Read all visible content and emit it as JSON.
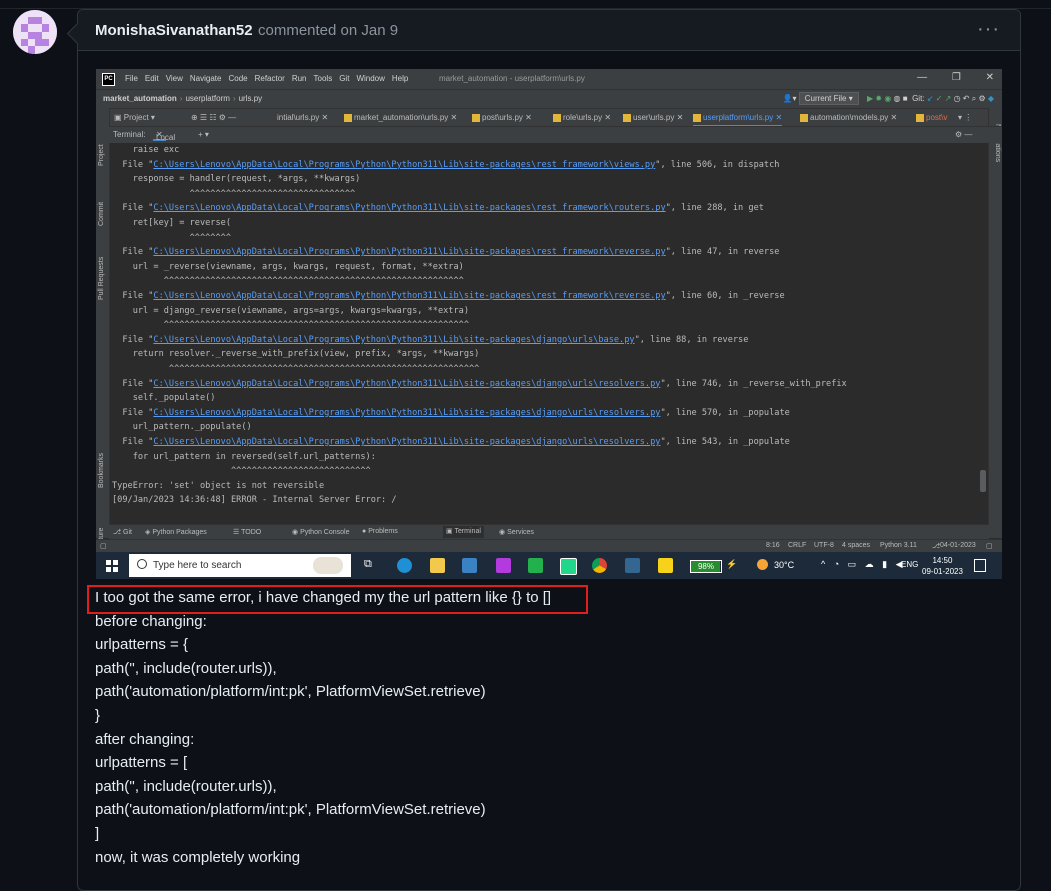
{
  "comment": {
    "author": "MonishaSivanathan52",
    "meta": "commented on Jan 9",
    "menu_icon": "kebab-icon",
    "highlight_color": "#e01e1e",
    "lines": [
      "I too got the same error, i have changed my the url pattern like {} to []",
      "before changing:",
      "urlpatterns = {",
      "path('', include(router.urls)),",
      "path('automation/platform/int:pk', PlatformViewSet.retrieve)",
      "}",
      "after changing:",
      "urlpatterns = [",
      "path('', include(router.urls)),",
      "path('automation/platform/int:pk', PlatformViewSet.retrieve)",
      "]",
      "now, it was completely working"
    ]
  },
  "ide": {
    "menu": [
      "File",
      "Edit",
      "View",
      "Navigate",
      "Code",
      "Refactor",
      "Run",
      "Tools",
      "Git",
      "Window",
      "Help"
    ],
    "window_title": "market_automation - userplatform\\urls.py",
    "breadcrumb": [
      "market_automation",
      "userplatform",
      "urls.py"
    ],
    "current_file": "Current File",
    "git_label": "Git:",
    "project_label": "Project",
    "tabs": [
      "intial\\urls.py",
      "market_automation\\urls.py",
      "post\\urls.py",
      "role\\urls.py",
      "user\\urls.py",
      "userplatform\\urls.py",
      "automation\\models.py",
      "post\\v"
    ],
    "terminal_label": "Terminal:",
    "local_tab": "Local",
    "left_tools": [
      "Project",
      "Commit",
      "Pull Requests",
      "Bookmarks",
      "Structure"
    ],
    "right_tools": [
      "Notifications"
    ],
    "terminal_lines": [
      {
        "pre": "    raise exc",
        "link": "",
        "post": ""
      },
      {
        "pre": "  File \"",
        "link": "C:\\Users\\Lenovo\\AppData\\Local\\Programs\\Python\\Python311\\Lib\\site-packages\\rest_framework\\views.py",
        "post": "\", line 506, in dispatch"
      },
      {
        "pre": "    response = handler(request, *args, **kwargs)",
        "link": "",
        "post": ""
      },
      {
        "pre": "               ^^^^^^^^^^^^^^^^^^^^^^^^^^^^^^^^",
        "link": "",
        "post": ""
      },
      {
        "pre": "  File \"",
        "link": "C:\\Users\\Lenovo\\AppData\\Local\\Programs\\Python\\Python311\\Lib\\site-packages\\rest_framework\\routers.py",
        "post": "\", line 288, in get"
      },
      {
        "pre": "    ret[key] = reverse(",
        "link": "",
        "post": ""
      },
      {
        "pre": "               ^^^^^^^^",
        "link": "",
        "post": ""
      },
      {
        "pre": "  File \"",
        "link": "C:\\Users\\Lenovo\\AppData\\Local\\Programs\\Python\\Python311\\Lib\\site-packages\\rest_framework\\reverse.py",
        "post": "\", line 47, in reverse"
      },
      {
        "pre": "    url = _reverse(viewname, args, kwargs, request, format, **extra)",
        "link": "",
        "post": ""
      },
      {
        "pre": "          ^^^^^^^^^^^^^^^^^^^^^^^^^^^^^^^^^^^^^^^^^^^^^^^^^^^^^^^^^^",
        "link": "",
        "post": ""
      },
      {
        "pre": "  File \"",
        "link": "C:\\Users\\Lenovo\\AppData\\Local\\Programs\\Python\\Python311\\Lib\\site-packages\\rest_framework\\reverse.py",
        "post": "\", line 60, in _reverse"
      },
      {
        "pre": "    url = django_reverse(viewname, args=args, kwargs=kwargs, **extra)",
        "link": "",
        "post": ""
      },
      {
        "pre": "          ^^^^^^^^^^^^^^^^^^^^^^^^^^^^^^^^^^^^^^^^^^^^^^^^^^^^^^^^^^^",
        "link": "",
        "post": ""
      },
      {
        "pre": "  File \"",
        "link": "C:\\Users\\Lenovo\\AppData\\Local\\Programs\\Python\\Python311\\Lib\\site-packages\\django\\urls\\base.py",
        "post": "\", line 88, in reverse"
      },
      {
        "pre": "    return resolver._reverse_with_prefix(view, prefix, *args, **kwargs)",
        "link": "",
        "post": ""
      },
      {
        "pre": "           ^^^^^^^^^^^^^^^^^^^^^^^^^^^^^^^^^^^^^^^^^^^^^^^^^^^^^^^^^^^^",
        "link": "",
        "post": ""
      },
      {
        "pre": "  File \"",
        "link": "C:\\Users\\Lenovo\\AppData\\Local\\Programs\\Python\\Python311\\Lib\\site-packages\\django\\urls\\resolvers.py",
        "post": "\", line 746, in _reverse_with_prefix"
      },
      {
        "pre": "    self._populate()",
        "link": "",
        "post": ""
      },
      {
        "pre": "  File \"",
        "link": "C:\\Users\\Lenovo\\AppData\\Local\\Programs\\Python\\Python311\\Lib\\site-packages\\django\\urls\\resolvers.py",
        "post": "\", line 570, in _populate"
      },
      {
        "pre": "    url_pattern._populate()",
        "link": "",
        "post": ""
      },
      {
        "pre": "  File \"",
        "link": "C:\\Users\\Lenovo\\AppData\\Local\\Programs\\Python\\Python311\\Lib\\site-packages\\django\\urls\\resolvers.py",
        "post": "\", line 543, in _populate"
      },
      {
        "pre": "    for url_pattern in reversed(self.url_patterns):",
        "link": "",
        "post": ""
      },
      {
        "pre": "                       ^^^^^^^^^^^^^^^^^^^^^^^^^^^",
        "link": "",
        "post": ""
      },
      {
        "pre": "TypeError: 'set' object is not reversible",
        "link": "",
        "post": ""
      },
      {
        "pre": "[09/Jan/2023 14:36:48] ERROR - Internal Server Error: /",
        "link": "",
        "post": ""
      }
    ],
    "bottom_tools": [
      "Git",
      "Python Packages",
      "TODO",
      "Python Console",
      "Problems",
      "Terminal",
      "Services"
    ],
    "status": {
      "position": "8:16",
      "line_ending": "CRLF",
      "encoding": "UTF-8",
      "indent": "4 spaces",
      "interpreter": "Python 3.11",
      "date": "04-01-2023"
    }
  },
  "taskbar": {
    "search_placeholder": "Type here to search",
    "battery": "98%",
    "battery_level": 0.98,
    "temperature": "30°C",
    "language": "ENG",
    "time": "14:50",
    "date": "09-01-2023"
  }
}
